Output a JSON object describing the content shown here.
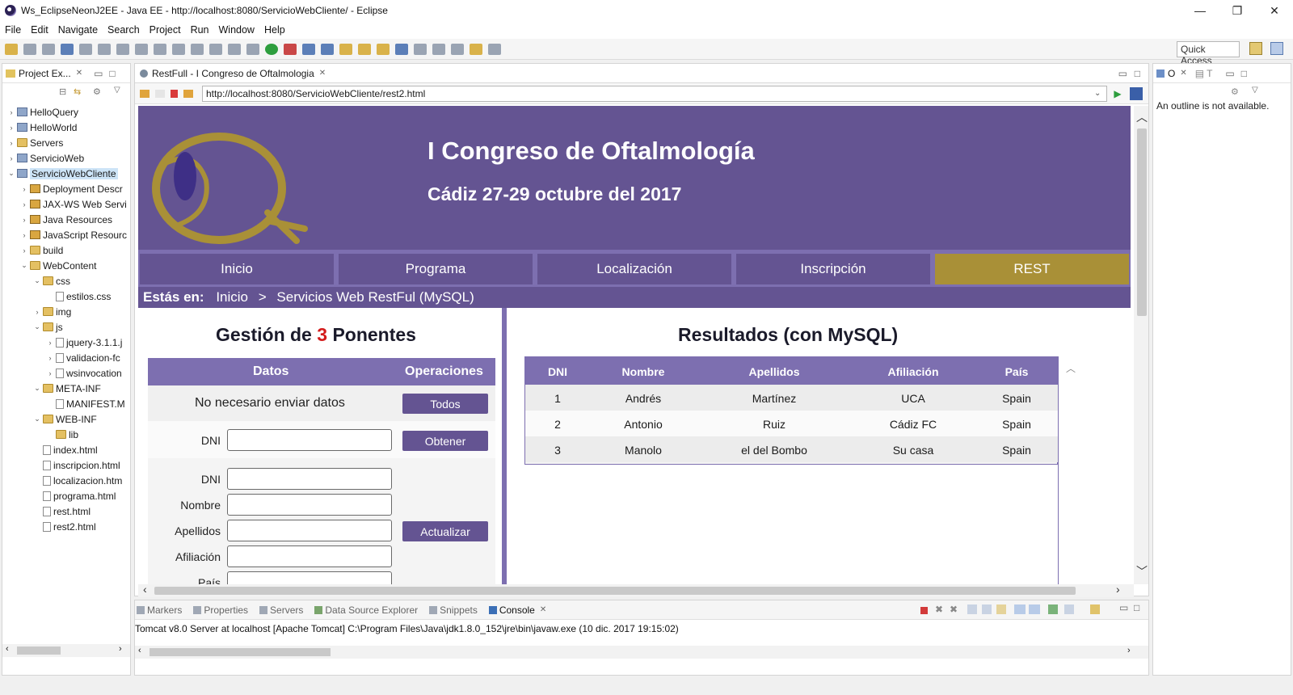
{
  "window": {
    "title": "Ws_EclipseNeonJ2EE - Java EE - http://localhost:8080/ServicioWebCliente/ - Eclipse",
    "min": "—",
    "max": "❐",
    "close": "✕"
  },
  "menu": [
    "File",
    "Edit",
    "Navigate",
    "Search",
    "Project",
    "Run",
    "Window",
    "Help"
  ],
  "quick_access": "Quick Access",
  "project_explorer": {
    "tab_label": "Project Ex...",
    "items": [
      {
        "label": "HelloQuery",
        "depth": 0,
        "arrow": "›",
        "icon": "proj"
      },
      {
        "label": "HelloWorld",
        "depth": 0,
        "arrow": "›",
        "icon": "proj"
      },
      {
        "label": "Servers",
        "depth": 0,
        "arrow": "›",
        "icon": "folder"
      },
      {
        "label": "ServicioWeb",
        "depth": 0,
        "arrow": "›",
        "icon": "proj"
      },
      {
        "label": "ServicioWebCliente",
        "depth": 0,
        "arrow": "⌄",
        "icon": "proj",
        "selected": true
      },
      {
        "label": "Deployment Descr",
        "depth": 1,
        "arrow": "›",
        "icon": "res"
      },
      {
        "label": "JAX-WS Web Servi",
        "depth": 1,
        "arrow": "›",
        "icon": "res"
      },
      {
        "label": "Java Resources",
        "depth": 1,
        "arrow": "›",
        "icon": "res"
      },
      {
        "label": "JavaScript Resourc",
        "depth": 1,
        "arrow": "›",
        "icon": "res"
      },
      {
        "label": "build",
        "depth": 1,
        "arrow": "›",
        "icon": "folder"
      },
      {
        "label": "WebContent",
        "depth": 1,
        "arrow": "⌄",
        "icon": "folder"
      },
      {
        "label": "css",
        "depth": 2,
        "arrow": "⌄",
        "icon": "folder"
      },
      {
        "label": "estilos.css",
        "depth": 3,
        "arrow": "",
        "icon": "file"
      },
      {
        "label": "img",
        "depth": 2,
        "arrow": "›",
        "icon": "folder"
      },
      {
        "label": "js",
        "depth": 2,
        "arrow": "⌄",
        "icon": "folder"
      },
      {
        "label": "jquery-3.1.1.j",
        "depth": 3,
        "arrow": "›",
        "icon": "file"
      },
      {
        "label": "validacion-fc",
        "depth": 3,
        "arrow": "›",
        "icon": "file"
      },
      {
        "label": "wsinvocation",
        "depth": 3,
        "arrow": "›",
        "icon": "file"
      },
      {
        "label": "META-INF",
        "depth": 2,
        "arrow": "⌄",
        "icon": "folder"
      },
      {
        "label": "MANIFEST.M",
        "depth": 3,
        "arrow": "",
        "icon": "file"
      },
      {
        "label": "WEB-INF",
        "depth": 2,
        "arrow": "⌄",
        "icon": "folder"
      },
      {
        "label": "lib",
        "depth": 3,
        "arrow": "",
        "icon": "folder"
      },
      {
        "label": "index.html",
        "depth": 2,
        "arrow": "",
        "icon": "file"
      },
      {
        "label": "inscripcion.html",
        "depth": 2,
        "arrow": "",
        "icon": "file"
      },
      {
        "label": "localizacion.htm",
        "depth": 2,
        "arrow": "",
        "icon": "file"
      },
      {
        "label": "programa.html",
        "depth": 2,
        "arrow": "",
        "icon": "file"
      },
      {
        "label": "rest.html",
        "depth": 2,
        "arrow": "",
        "icon": "file"
      },
      {
        "label": "rest2.html",
        "depth": 2,
        "arrow": "",
        "icon": "file"
      }
    ]
  },
  "editor": {
    "tab_label": "RestFull - I Congreso de Oftalmologia",
    "url": "http://localhost:8080/ServicioWebCliente/rest2.html"
  },
  "web": {
    "title": "I Congreso de Oftalmología",
    "subtitle": "Cádiz 27-29 octubre del 2017",
    "nav": [
      {
        "label": "Inicio",
        "active": false
      },
      {
        "label": "Programa",
        "active": false
      },
      {
        "label": "Localización",
        "active": false
      },
      {
        "label": "Inscripción",
        "active": false
      },
      {
        "label": "REST",
        "active": true
      }
    ],
    "breadcrumb_prefix": "Estás en:",
    "breadcrumb_home": "Inicio",
    "breadcrumb_sep": ">",
    "breadcrumb_current": "Servicios Web RestFul (MySQL)",
    "gestion_pre": "Gestión de",
    "gestion_count": "3",
    "gestion_post": "Ponentes",
    "form_head_datos": "Datos",
    "form_head_ops": "Operaciones",
    "no_data_msg": "No necesario enviar datos",
    "btn_todos": "Todos",
    "label_dni": "DNI",
    "btn_obtener": "Obtener",
    "label_dni2": "DNI",
    "label_nombre": "Nombre",
    "label_apellidos": "Apellidos",
    "btn_actualizar": "Actualizar",
    "label_afiliacion": "Afiliación",
    "label_pais": "País",
    "results_title": "Resultados (con MySQL)",
    "results_columns": [
      "DNI",
      "Nombre",
      "Apellidos",
      "Afiliación",
      "País"
    ],
    "results_rows": [
      [
        "1",
        "Andrés",
        "Martínez",
        "UCA",
        "Spain"
      ],
      [
        "2",
        "Antonio",
        "Ruiz",
        "Cádiz FC",
        "Spain"
      ],
      [
        "3",
        "Manolo",
        "el del Bombo",
        "Su casa",
        "Spain"
      ]
    ]
  },
  "outline": {
    "tab_label": "O",
    "tab2_label": "T",
    "message": "An outline is not available."
  },
  "console": {
    "tabs": [
      "Markers",
      "Properties",
      "Servers",
      "Data Source Explorer",
      "Snippets",
      "Console"
    ],
    "active_tab": "Console",
    "text": "Tomcat v8.0 Server at localhost [Apache Tomcat] C:\\Program Files\\Java\\jdk1.8.0_152\\jre\\bin\\javaw.exe (10 dic. 2017 19:15:02)"
  },
  "colors": {
    "header_purple": "#645492",
    "nav_light_purple": "#7d6fb0",
    "active_gold": "#a99037",
    "count_red": "#d31b1b"
  }
}
